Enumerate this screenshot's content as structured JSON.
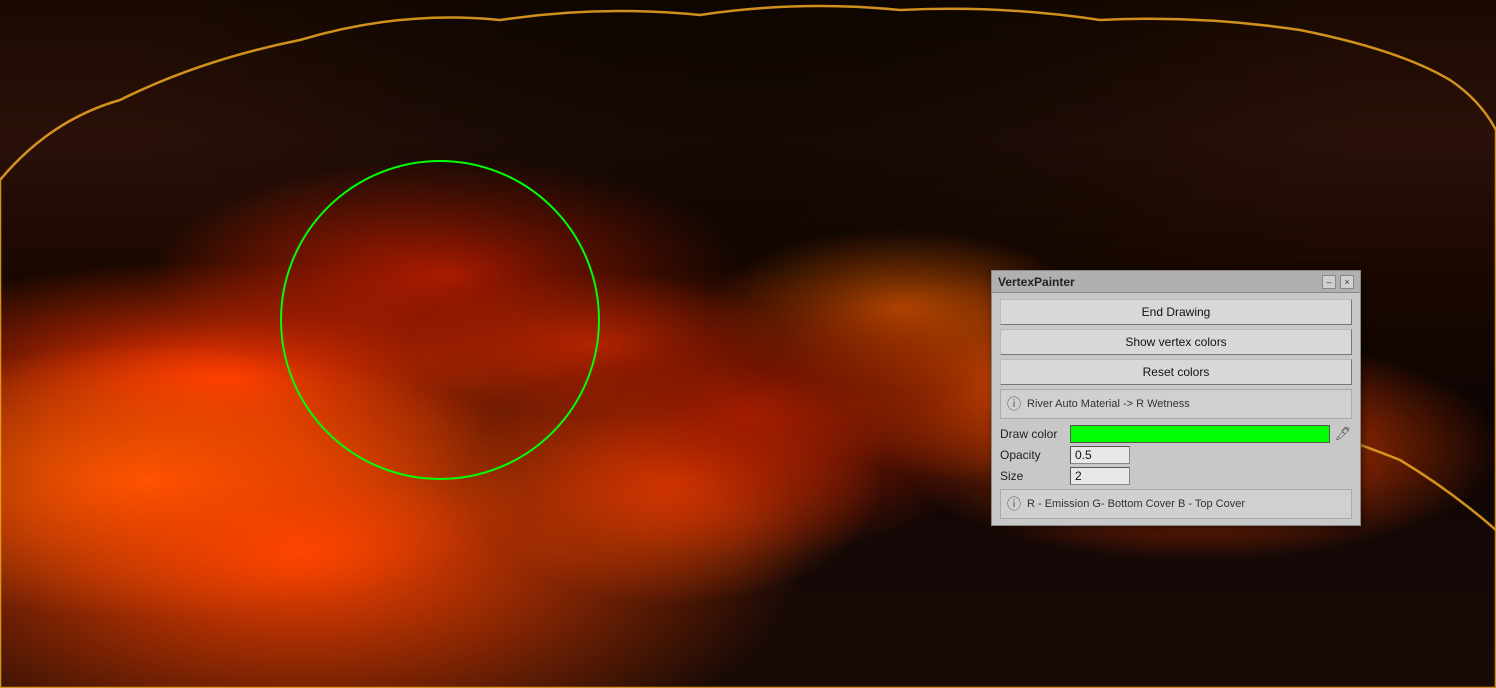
{
  "viewport": {
    "background_description": "Lava rock terrain"
  },
  "panel": {
    "title": "VertexPainter",
    "minimize_label": "–",
    "close_label": "×",
    "buttons": {
      "end_drawing": "End Drawing",
      "show_vertex_colors": "Show vertex colors",
      "reset_colors": "Reset colors"
    },
    "info_top": {
      "icon": "ⓘ",
      "text": "River Auto Material -> R Wetness"
    },
    "properties": {
      "draw_color_label": "Draw color",
      "draw_color_value": "#00ff00",
      "opacity_label": "Opacity",
      "opacity_value": "0.5",
      "size_label": "Size",
      "size_value": "2"
    },
    "info_bottom": {
      "icon": "ⓘ",
      "text": "R - Emission G- Bottom Cover B - Top Cover"
    }
  }
}
